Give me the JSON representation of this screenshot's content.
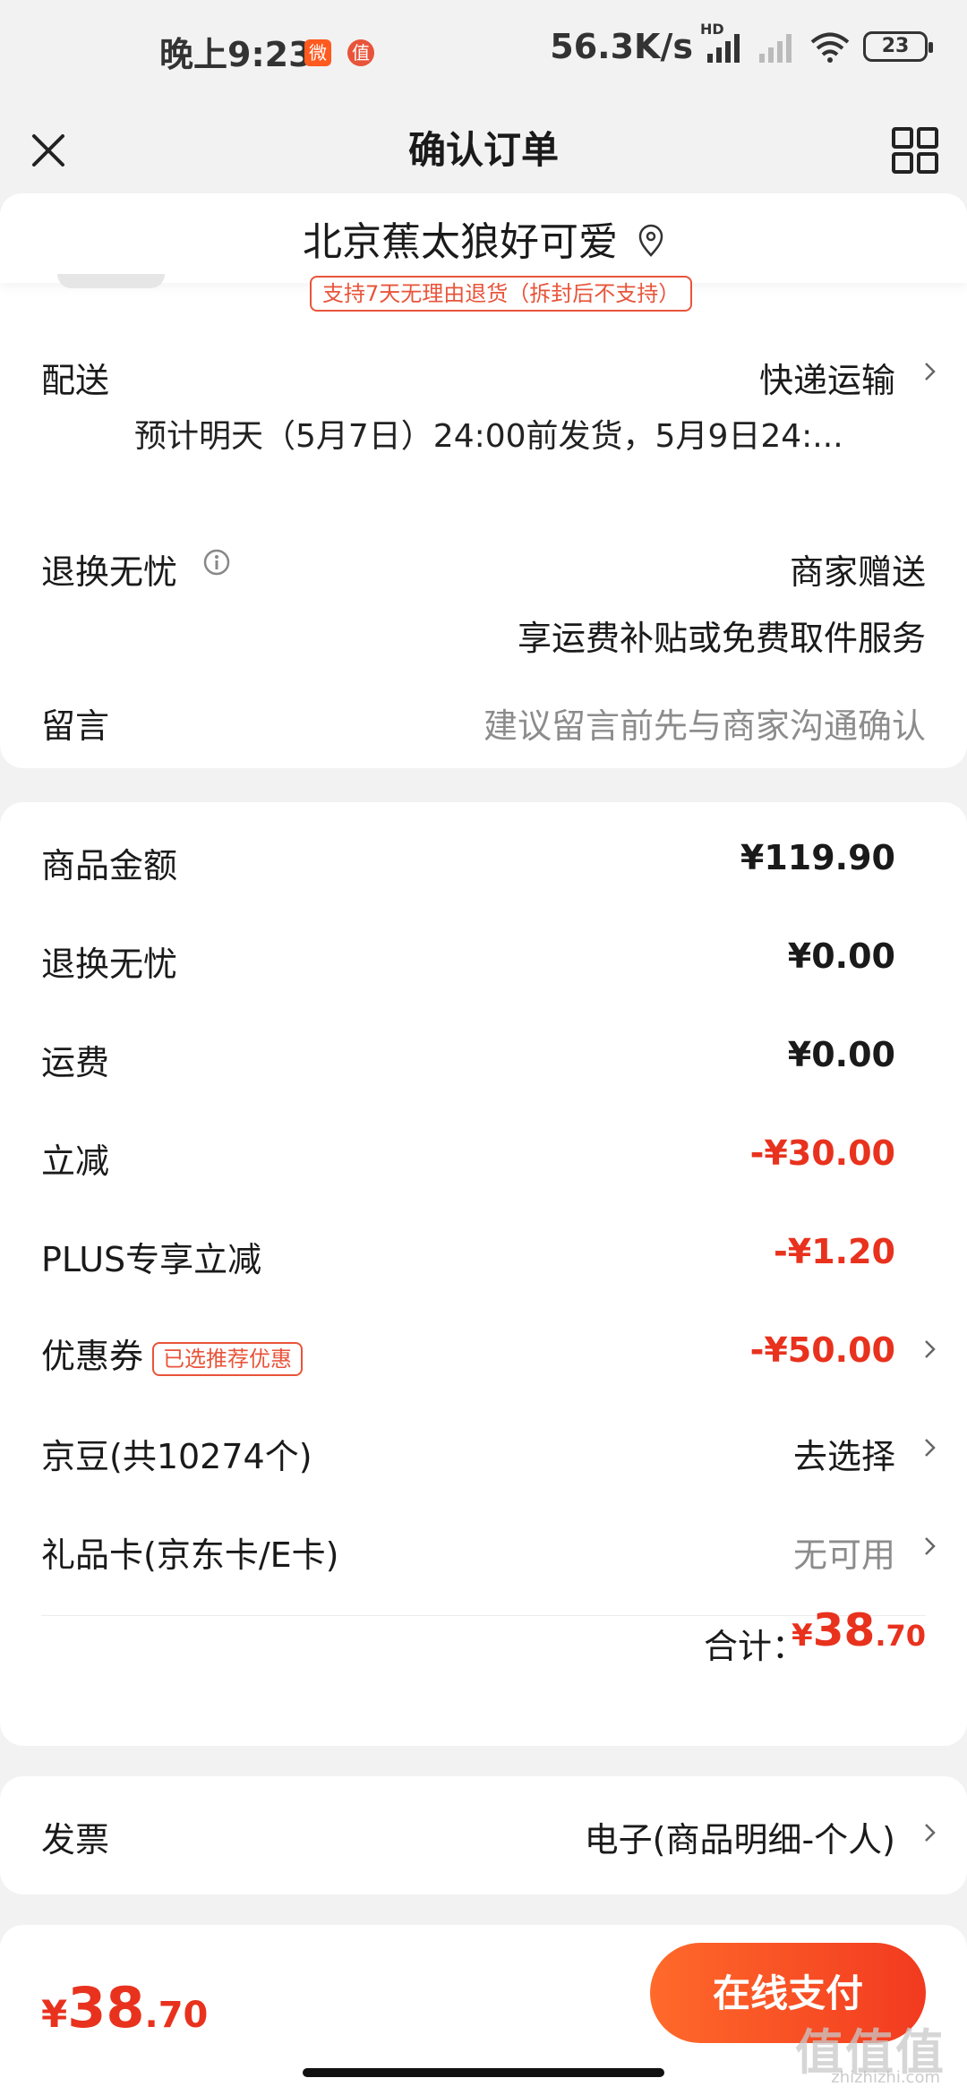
{
  "status_bar": {
    "time": "晚上9:23",
    "app_icon_1": "微",
    "app_icon_2": "值",
    "net_speed": "56.3K/s",
    "signal_label": "HD",
    "battery": "23"
  },
  "header": {
    "title": "确认订单"
  },
  "address": {
    "text": "北京蕉太狼好可爱",
    "return_tag": "支持7天无理由退货（拆封后不支持）"
  },
  "delivery_card": {
    "delivery_label": "配送",
    "delivery_value": "快递运输",
    "delivery_note": "预计明天（5月7日）24:00前发货，5月9日24:...",
    "return_label": "退换无忧",
    "return_value": "商家赠送",
    "return_note": "享运费补贴或免费取件服务",
    "message_label": "留言",
    "message_placeholder": "建议留言前先与商家沟通确认"
  },
  "price_card": {
    "rows": [
      {
        "label": "商品金额",
        "value": "¥119.90"
      },
      {
        "label": "退换无忧",
        "value": "¥0.00"
      },
      {
        "label": "运费",
        "value": "¥0.00"
      },
      {
        "label": "立减",
        "value": "-¥30.00"
      },
      {
        "label": "PLUS专享立减",
        "value": "-¥1.20"
      },
      {
        "label": "优惠券",
        "tag": "已选推荐优惠",
        "value": "-¥50.00"
      },
      {
        "label": "京豆(共10274个)",
        "value": "去选择"
      },
      {
        "label": "礼品卡(京东卡/E卡)",
        "value": "无可用"
      }
    ],
    "total_label": "合计：",
    "total_currency": "¥",
    "total_int": "38",
    "total_dec": ".70"
  },
  "invoice_card": {
    "label": "发票",
    "value": "电子(商品明细-个人)"
  },
  "bottom_bar": {
    "currency": "¥",
    "amount_int": "38",
    "amount_dec": ".70",
    "pay_label": "在线支付"
  },
  "watermark": {
    "text": "值值值",
    "sub": "zhizhizhi.com"
  },
  "colors": {
    "accent": "#e8321e",
    "pay_gradient_start": "#ff6a2a",
    "pay_gradient_end": "#f23a20"
  }
}
